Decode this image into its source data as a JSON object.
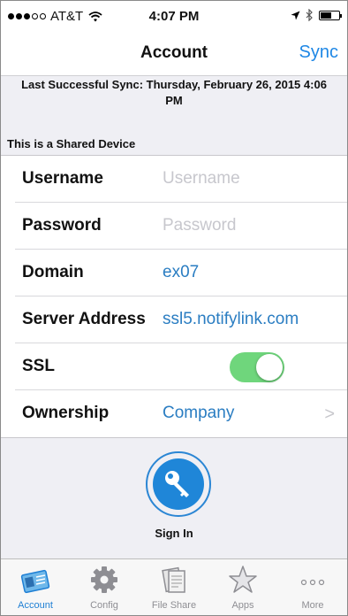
{
  "status_bar": {
    "carrier": "AT&T",
    "time": "4:07 PM"
  },
  "nav": {
    "title": "Account",
    "sync_label": "Sync"
  },
  "last_sync": {
    "line1": "Last Successful Sync: Thursday, February 26, 2015 4:06",
    "line2": "PM"
  },
  "section_header": "This is a Shared Device",
  "form": {
    "username_label": "Username",
    "username_placeholder": "Username",
    "password_label": "Password",
    "password_placeholder": "Password",
    "domain_label": "Domain",
    "domain_value": "ex07",
    "server_label": "Server Address",
    "server_value": "ssl5.notifylink.com",
    "ssl_label": "SSL",
    "ssl_on": true,
    "ownership_label": "Ownership",
    "ownership_value": "Company"
  },
  "signin_label": "Sign In",
  "tabs": [
    {
      "label": "Account",
      "icon": "account-card-icon",
      "active": true
    },
    {
      "label": "Config",
      "icon": "gear-icon",
      "active": false
    },
    {
      "label": "File Share",
      "icon": "file-share-icon",
      "active": false
    },
    {
      "label": "Apps",
      "icon": "star-icon",
      "active": false
    },
    {
      "label": "More",
      "icon": "more-dots-icon",
      "active": false
    }
  ],
  "colors": {
    "accent": "#1e87e5",
    "toggle_on": "#6fd67c",
    "placeholder": "#c7c7cd"
  }
}
